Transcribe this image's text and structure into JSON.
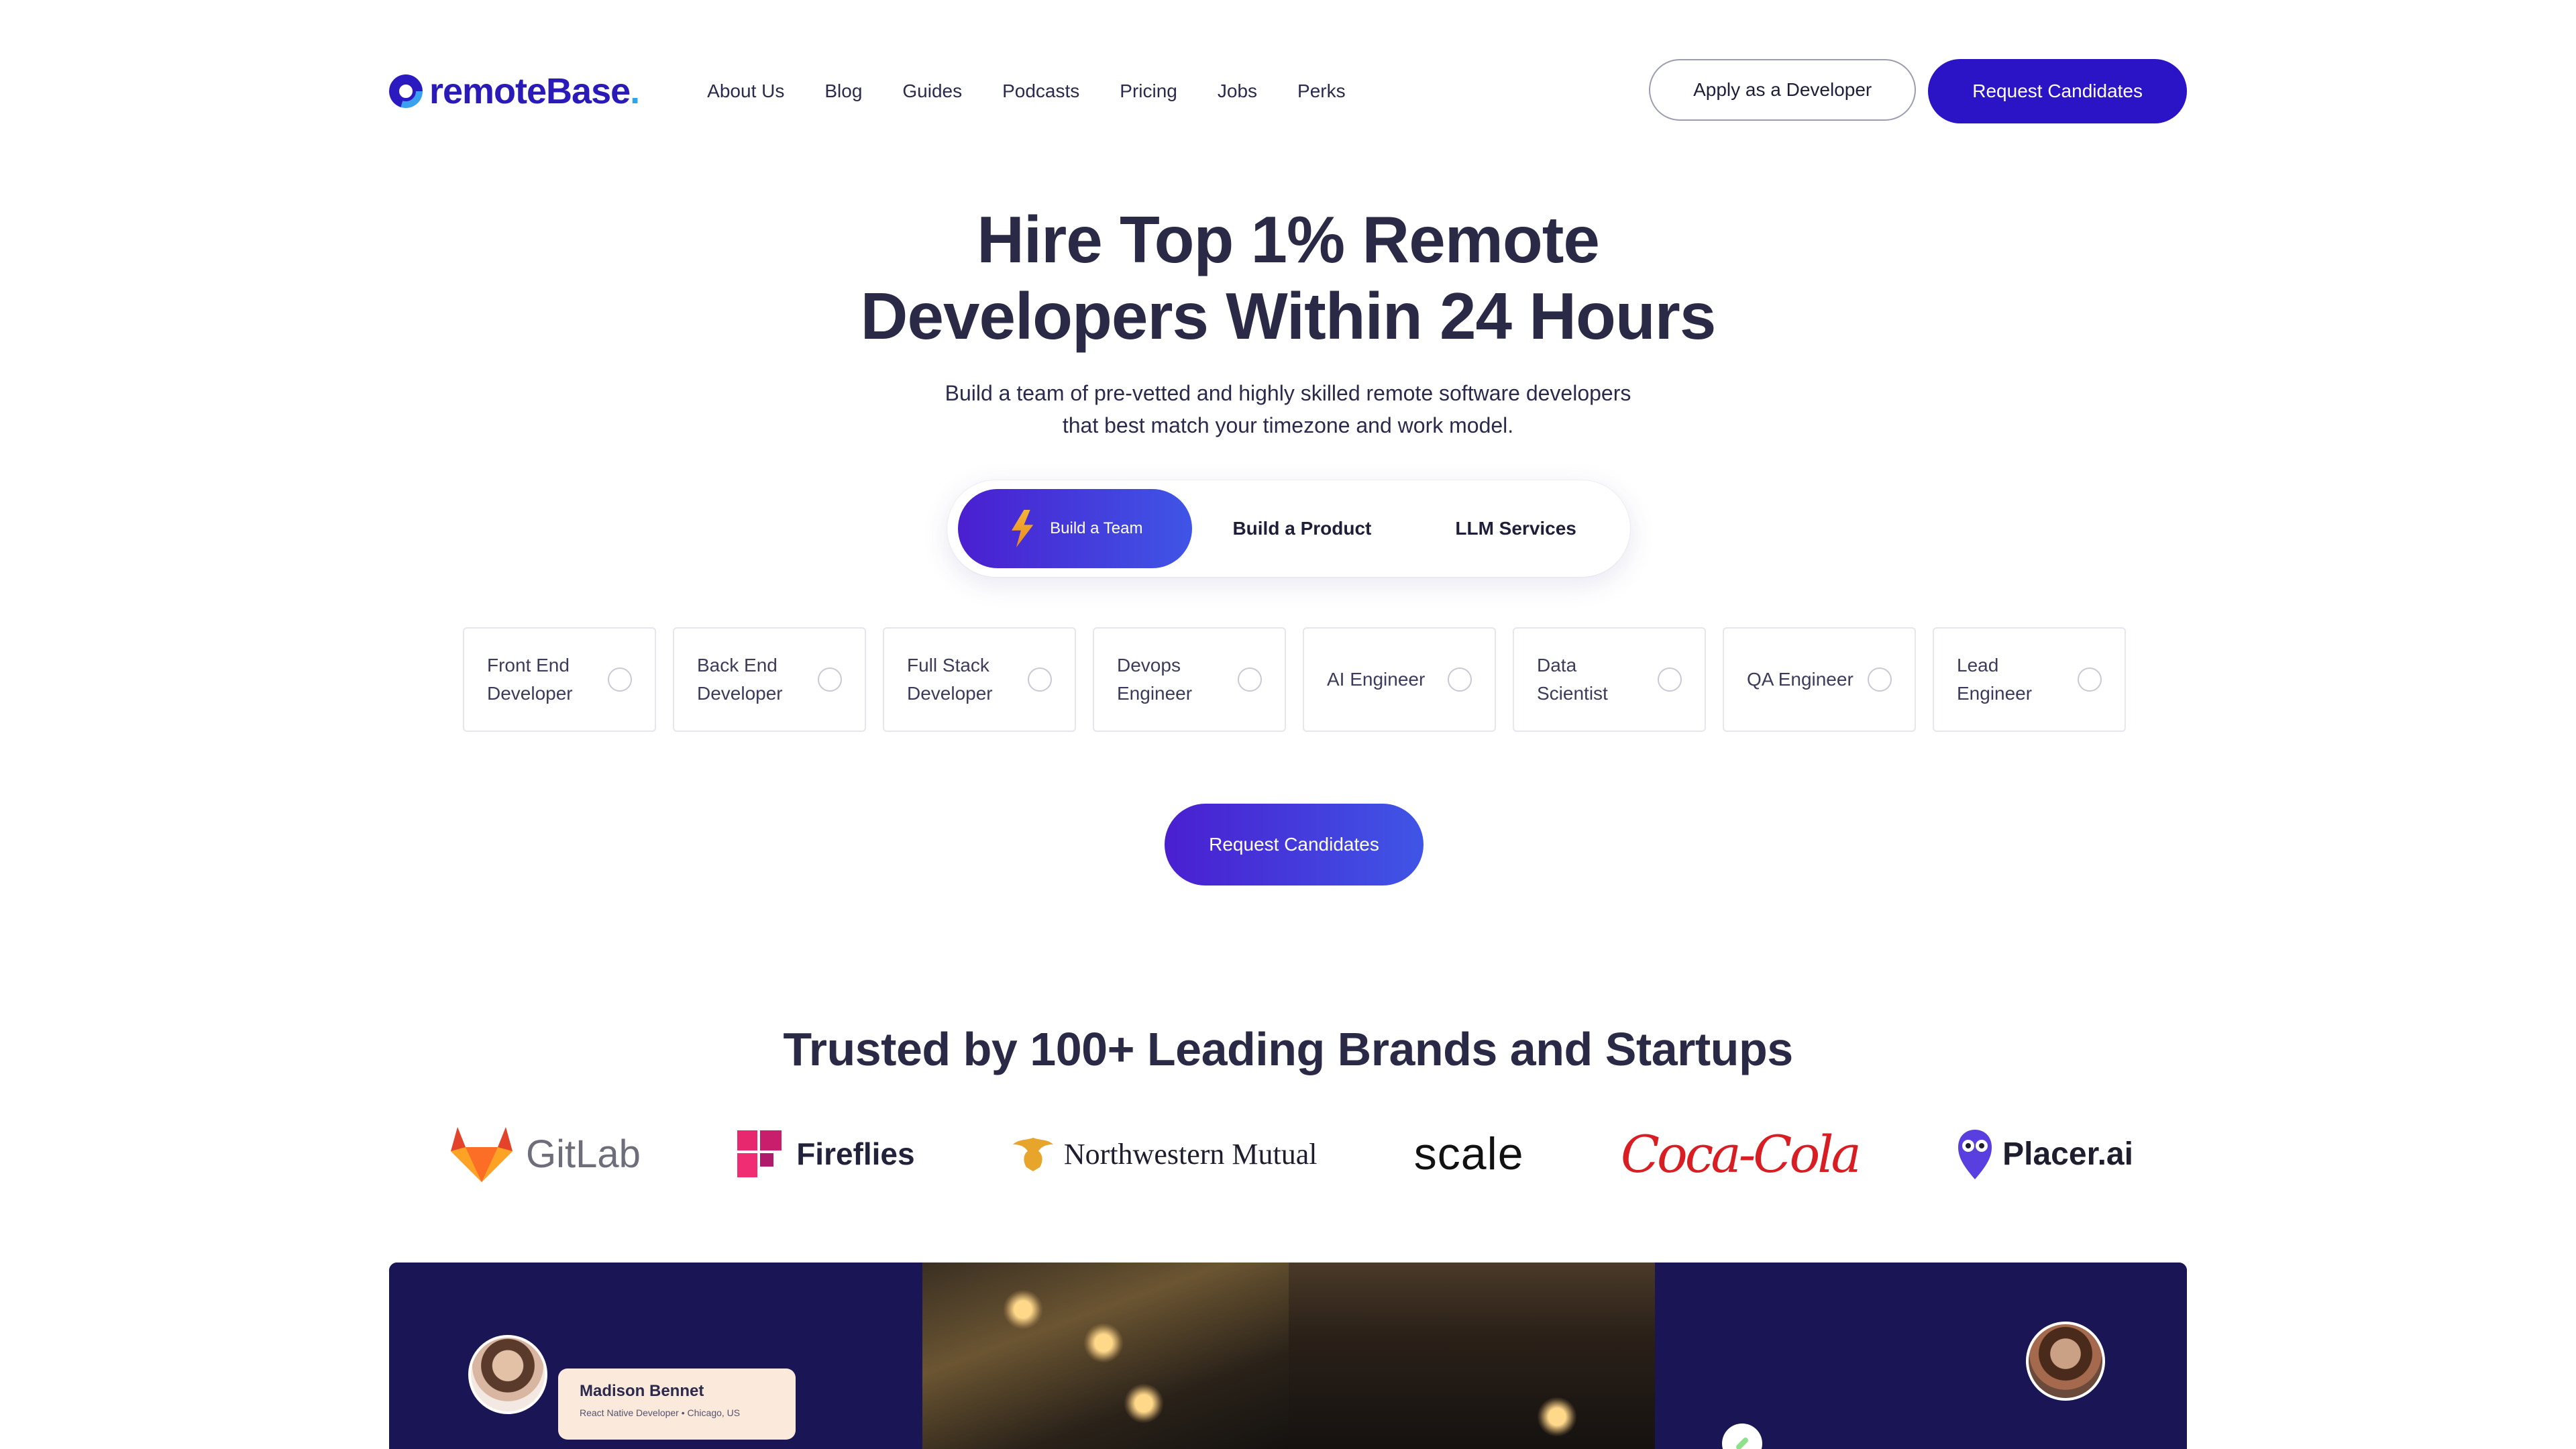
{
  "header": {
    "logo_text": "remoteBase",
    "logo_dot": ".",
    "nav": [
      "About Us",
      "Blog",
      "Guides",
      "Podcasts",
      "Pricing",
      "Jobs",
      "Perks"
    ],
    "apply_label": "Apply as a Developer",
    "request_label": "Request Candidates"
  },
  "hero": {
    "title_line1": "Hire Top 1% Remote",
    "title_line2": "Developers Within 24 Hours",
    "subtitle_line1": "Build a team of pre-vetted and highly skilled remote software developers",
    "subtitle_line2": "that best match your timezone and work model.",
    "tabs": [
      {
        "label": "Build a Team",
        "active": true,
        "icon": "lightning-icon"
      },
      {
        "label": "Build a Product",
        "active": false
      },
      {
        "label": "LLM Services",
        "active": false
      }
    ],
    "roles": [
      "Front End Developer",
      "Back End Developer",
      "Full Stack Developer",
      "Devops Engineer",
      "AI Engineer",
      "Data Scientist",
      "QA Engineer",
      "Lead Engineer"
    ],
    "cta_label": "Request Candidates"
  },
  "trusted": {
    "title": "Trusted by 100+ Leading Brands and Startups",
    "brands": [
      "GitLab",
      "Fireflies",
      "Northwestern Mutual",
      "scale",
      "Coca-Cola",
      "Placer.ai"
    ]
  },
  "banner": {
    "card_name": "Madison Bennet",
    "card_meta": "React Native Developer • Chicago, US"
  },
  "colors": {
    "primary": "#2a14c6",
    "gradient_start": "#4a1fd0",
    "gradient_end": "#3f55e6",
    "heading": "#2a2946",
    "banner_bg": "#1a1555"
  }
}
